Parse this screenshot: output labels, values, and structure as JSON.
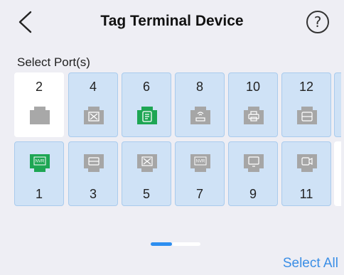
{
  "header": {
    "title": "Tag Terminal Device",
    "help_glyph": "?"
  },
  "section_label": "Select Port(s)",
  "colors": {
    "selected_port": "#cfe2f6",
    "empty_port": "#ffffff",
    "active_device": "#1ea654",
    "inactive_device": "#a6a6a6",
    "accent": "#3a8ee6"
  },
  "ports": {
    "top_row": [
      {
        "number": "2",
        "state": "empty",
        "icon": "empty-port-icon"
      },
      {
        "number": "4",
        "state": "selected",
        "icon": "switch-device-icon"
      },
      {
        "number": "6",
        "state": "selected",
        "icon": "storage-device-icon",
        "online": true
      },
      {
        "number": "8",
        "state": "selected",
        "icon": "wireless-ap-icon"
      },
      {
        "number": "10",
        "state": "selected",
        "icon": "printer-icon"
      },
      {
        "number": "12",
        "state": "selected",
        "icon": "server-icon"
      }
    ],
    "bottom_row": [
      {
        "number": "1",
        "state": "selected",
        "icon": "nvr-icon",
        "online": true,
        "badge": "NVR"
      },
      {
        "number": "3",
        "state": "selected",
        "icon": "dvr-icon"
      },
      {
        "number": "5",
        "state": "selected",
        "icon": "switch-device-icon"
      },
      {
        "number": "7",
        "state": "selected",
        "icon": "nvr-icon",
        "badge": "NVR"
      },
      {
        "number": "9",
        "state": "selected",
        "icon": "monitor-icon"
      },
      {
        "number": "11",
        "state": "selected",
        "icon": "camera-icon"
      }
    ]
  },
  "pager": {
    "pages": 2,
    "current": 1
  },
  "select_all_label": "Select All"
}
